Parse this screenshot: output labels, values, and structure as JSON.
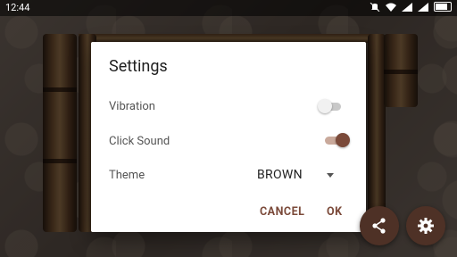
{
  "status_bar": {
    "time": "12:44",
    "icons": [
      "mute-icon",
      "wifi-icon",
      "signal-icon",
      "signal-icon",
      "battery-icon"
    ]
  },
  "dialog": {
    "title": "Settings",
    "vibration": {
      "label": "Vibration",
      "on": false
    },
    "click_sound": {
      "label": "Click Sound",
      "on": true
    },
    "theme": {
      "label": "Theme",
      "value": "BROWN"
    },
    "cancel_label": "CANCEL",
    "ok_label": "OK"
  },
  "colors": {
    "accent": "#7b4a3a",
    "fab": "#4e3126"
  }
}
